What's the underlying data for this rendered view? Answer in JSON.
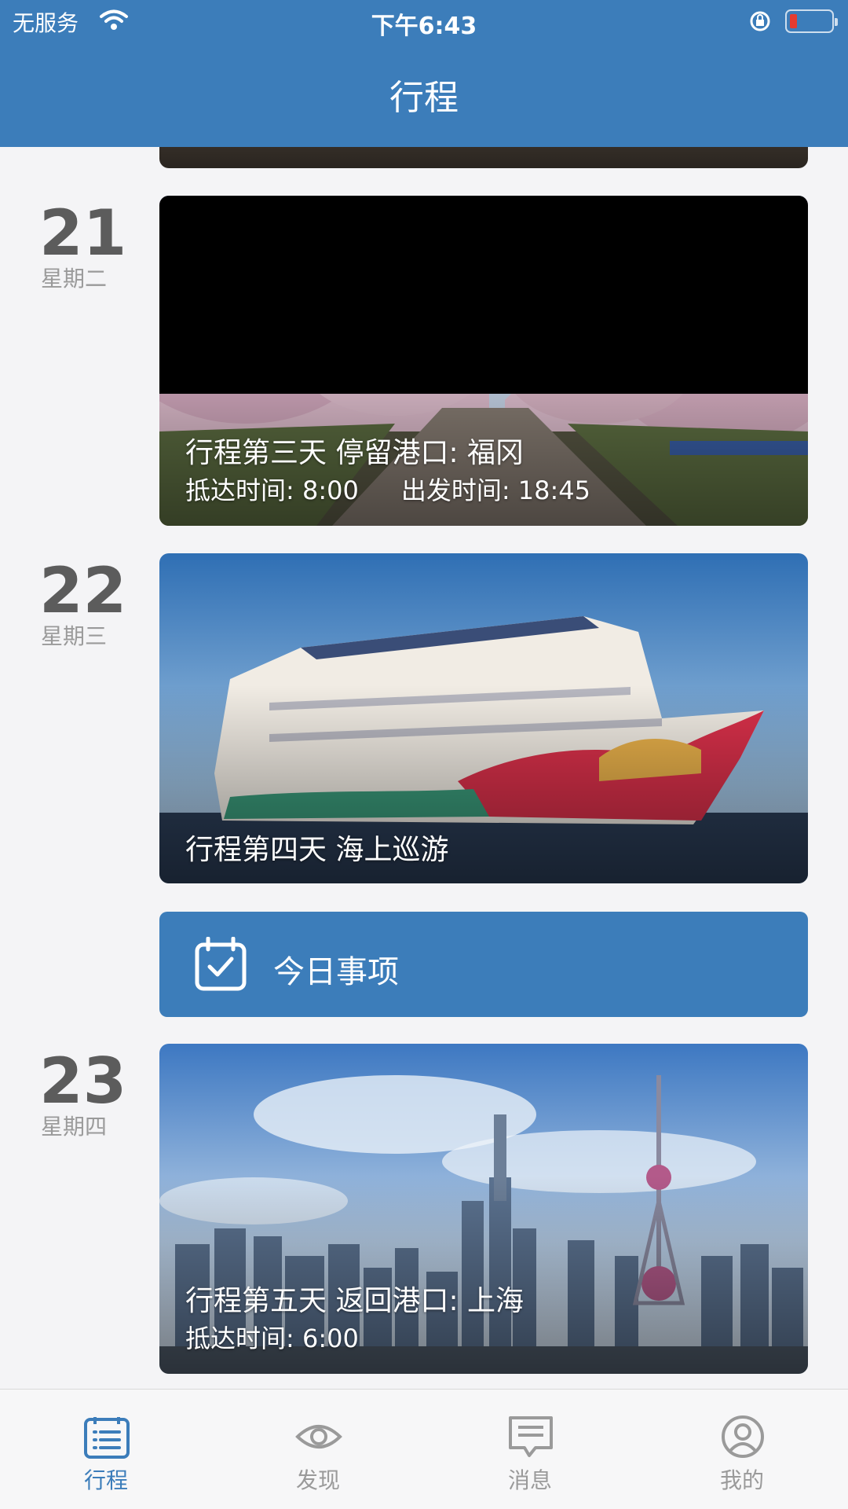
{
  "status": {
    "carrier": "无服务",
    "time": "下午6:43"
  },
  "nav": {
    "title": "行程"
  },
  "days": [
    {
      "day": "21",
      "weekday": "星期二",
      "title": "行程第三天 停留港口: 福冈",
      "arrive": "抵达时间: 8:00",
      "depart": "出发时间: 18:45"
    },
    {
      "day": "22",
      "weekday": "星期三",
      "title": "行程第四天 海上巡游"
    },
    {
      "day": "23",
      "weekday": "星期四",
      "title": "行程第五天  返回港口: 上海",
      "arrive": "抵达时间: 6:00"
    }
  ],
  "todo": {
    "label": "今日事项"
  },
  "tabs": [
    {
      "label": "行程",
      "active": true
    },
    {
      "label": "发现"
    },
    {
      "label": "消息"
    },
    {
      "label": "我的"
    }
  ],
  "colors": {
    "primary": "#3c7dba",
    "inactive": "#9a9a9a"
  }
}
